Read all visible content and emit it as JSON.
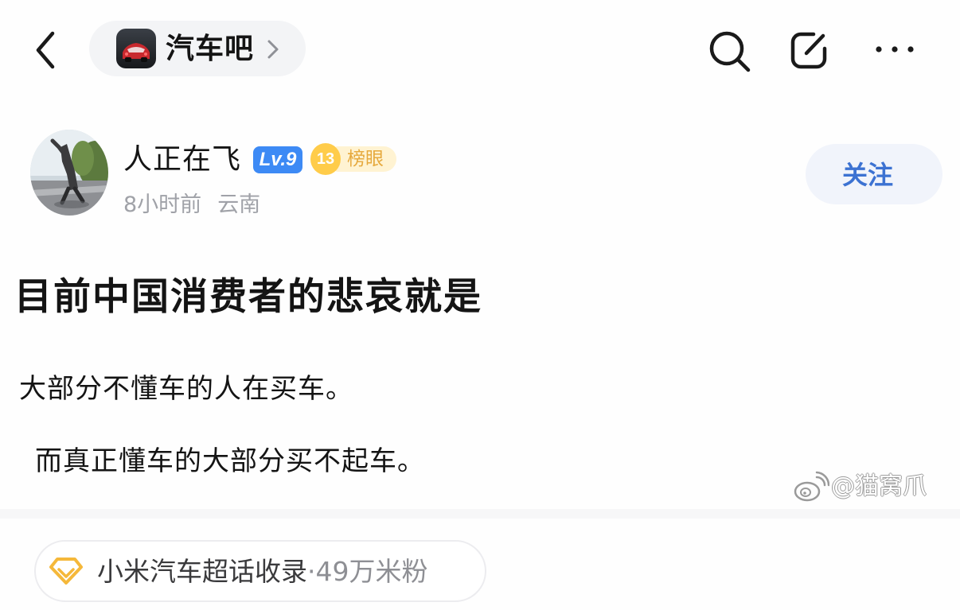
{
  "nav": {
    "forum_name": "汽车吧",
    "icons": {
      "back": "chevron-left-icon",
      "forum_chevron": "chevron-right-icon",
      "search": "search-icon",
      "edit": "edit-icon",
      "more": "more-icon"
    }
  },
  "author": {
    "name": "人正在飞",
    "level": "Lv.9",
    "rank_number": "13",
    "rank_label": "榜眼",
    "time": "8小时前",
    "location": "云南",
    "follow_label": "关注"
  },
  "post": {
    "title": "目前中国消费者的悲哀就是",
    "lines": [
      "大部分不懂车的人在买车。",
      "而真正懂车的大部分买不起车。"
    ]
  },
  "watermark": {
    "text": "@猫窝爪",
    "icon": "weibo-icon"
  },
  "topic": {
    "name": "小米汽车超话收录",
    "separator": "·",
    "fans": "49万米粉",
    "icon": "diamond-icon"
  },
  "colors": {
    "accent": "#3c72d2",
    "level_badge": "#3d8af5",
    "rank_gold": "#ffcc4a",
    "rank_text": "#e6a93d",
    "meta_gray": "#a0a2a8",
    "topic_icon": "#f5b83a"
  }
}
